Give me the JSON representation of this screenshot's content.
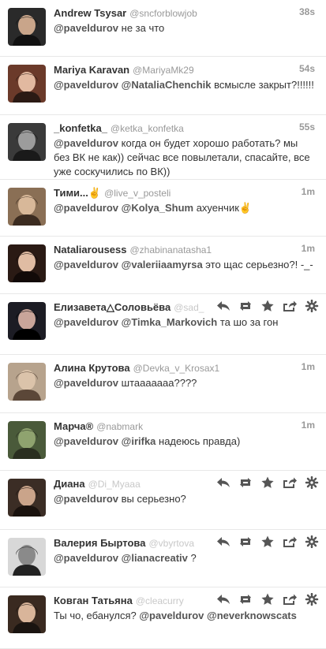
{
  "tweets": [
    {
      "name": "Andrew Tsysar",
      "handle": "@sncforblowjob",
      "time": "38s",
      "parts": [
        [
          "m",
          "@paveldurov"
        ],
        [
          "t",
          " не за что"
        ]
      ],
      "actions": false
    },
    {
      "name": "Mariya Karavan",
      "handle": "@MariyaMk29",
      "time": "54s",
      "parts": [
        [
          "m",
          "@paveldurov"
        ],
        [
          "t",
          " "
        ],
        [
          "m",
          "@NataliaChenchik"
        ],
        [
          "t",
          " всмысле закрыт?!!!!!!"
        ]
      ],
      "actions": false
    },
    {
      "name": "_konfetka_",
      "handle": "@ketka_konfetka",
      "time": "55s",
      "parts": [
        [
          "m",
          "@paveldurov"
        ],
        [
          "t",
          " когда он будет хорошо работать? мы без ВК не как)) сейчас все повылетали, спасайте, все уже соскучились по ВК))"
        ]
      ],
      "actions": false
    },
    {
      "name": "Тими...✌",
      "handle": "@live_v_posteli",
      "time": "1m",
      "parts": [
        [
          "m",
          "@paveldurov"
        ],
        [
          "t",
          " "
        ],
        [
          "m",
          "@Kolya_Shum"
        ],
        [
          "t",
          " ахуенчик✌"
        ]
      ],
      "actions": false
    },
    {
      "name": "Nataliarousess",
      "handle": "@zhabinanatasha1",
      "time": "1m",
      "parts": [
        [
          "m",
          "@paveldurov"
        ],
        [
          "t",
          " "
        ],
        [
          "m",
          "@valeriiaamyrsa"
        ],
        [
          "t",
          " это щас серьезно?! -_-"
        ]
      ],
      "actions": false
    },
    {
      "name": "Елизавета△Соловьёва",
      "handle": "@sad_",
      "time": "",
      "parts": [
        [
          "m",
          "@paveldurov"
        ],
        [
          "t",
          " "
        ],
        [
          "m",
          "@Timka_Markovich"
        ],
        [
          "t",
          " та шо за гон"
        ]
      ],
      "actions": true
    },
    {
      "name": "Алина Крутова",
      "handle": "@Devka_v_Krosax1",
      "time": "1m",
      "parts": [
        [
          "m",
          "@paveldurov"
        ],
        [
          "t",
          " штааааааа????"
        ]
      ],
      "actions": false
    },
    {
      "name": "Марча®",
      "handle": "@nabmark",
      "time": "1m",
      "parts": [
        [
          "m",
          "@paveldurov"
        ],
        [
          "t",
          " "
        ],
        [
          "m",
          "@irifka"
        ],
        [
          "t",
          " надеюсь правда)"
        ]
      ],
      "actions": false
    },
    {
      "name": "Диана",
      "handle": "@Di_Myaaa",
      "time": "",
      "parts": [
        [
          "m",
          "@paveldurov"
        ],
        [
          "t",
          " вы серьезно?"
        ]
      ],
      "actions": true
    },
    {
      "name": "Валерия Быртова",
      "handle": "@vbyrtova",
      "time": "",
      "parts": [
        [
          "m",
          "@paveldurov"
        ],
        [
          "t",
          " "
        ],
        [
          "m",
          "@lianacreativ"
        ],
        [
          "t",
          " ?"
        ]
      ],
      "actions": true
    },
    {
      "name": "Ковган Татьяна",
      "handle": "@cleacurry",
      "time": "",
      "parts": [
        [
          "t",
          "Ты чо, ебанулся? "
        ],
        [
          "m",
          "@paveldurov"
        ],
        [
          "t",
          " "
        ],
        [
          "m",
          "@neverknowscats"
        ]
      ],
      "actions": true
    }
  ],
  "icons": {
    "reply": "reply-icon",
    "retweet": "retweet-icon",
    "favorite": "star-icon",
    "share": "share-icon",
    "more": "gear-icon"
  },
  "colors": {
    "name": "#333333",
    "handle": "#999999",
    "mention": "#555555",
    "action": "#555555",
    "divider": "#e8e8e8"
  }
}
